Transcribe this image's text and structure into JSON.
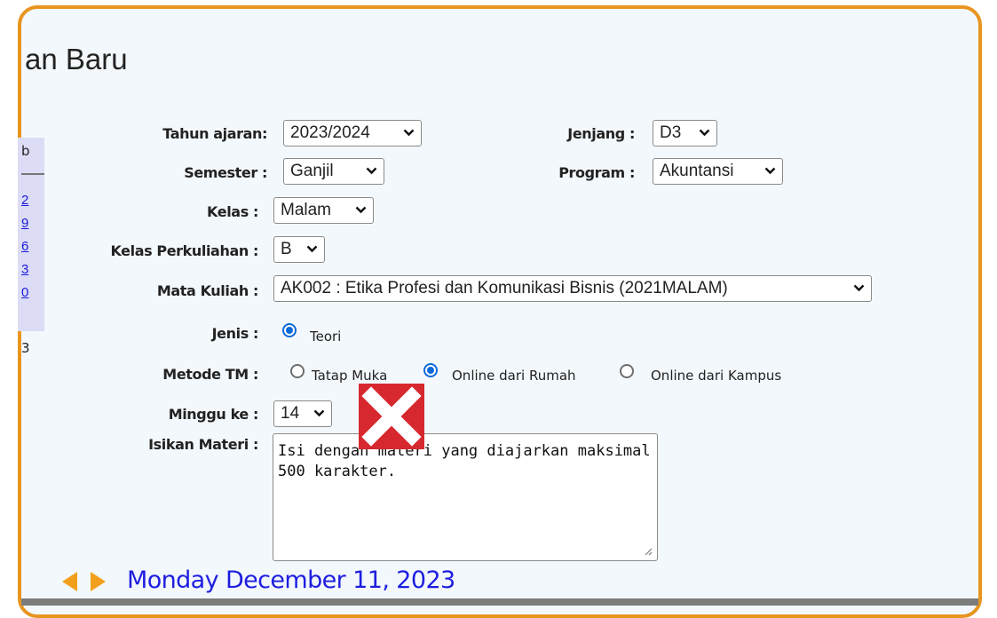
{
  "page_title": "an Baru",
  "sidebar": {
    "header": "b",
    "links": [
      "2",
      "9",
      "6",
      "3",
      "0"
    ],
    "extra": "3"
  },
  "form": {
    "tahun_ajaran": {
      "label": "Tahun ajaran:",
      "value": "2023/2024"
    },
    "jenjang": {
      "label": "Jenjang :",
      "value": "D3"
    },
    "semester": {
      "label": "Semester :",
      "value": "Ganjil"
    },
    "program": {
      "label": "Program :",
      "value": "Akuntansi"
    },
    "kelas": {
      "label": "Kelas :",
      "value": "Malam"
    },
    "kelas_perkuliahan": {
      "label": "Kelas Perkuliahan :",
      "value": "B"
    },
    "mata_kuliah": {
      "label": "Mata Kuliah :",
      "value": "AK002 : Etika Profesi dan Komunikasi Bisnis (2021MALAM)"
    },
    "jenis": {
      "label": "Jenis :",
      "options": [
        {
          "label": "Teori",
          "checked": true
        }
      ]
    },
    "metode_tm": {
      "label": "Metode TM :",
      "options": [
        {
          "label": "Tatap Muka",
          "checked": false
        },
        {
          "label": "Online dari Rumah",
          "checked": true
        },
        {
          "label": "Online dari Kampus",
          "checked": false
        }
      ]
    },
    "minggu_ke": {
      "label": "Minggu ke :",
      "value": "14"
    },
    "isikan_materi": {
      "label": "Isikan Materi :",
      "placeholder": "Isi dengan materi yang diajarkan maksimal 500 karakter."
    }
  },
  "footer": {
    "date": "Monday December 11, 2023"
  },
  "colors": {
    "frame_border": "#e8951f",
    "link": "#1a1ad8",
    "close_icon": "#d7282f",
    "date": "#1e1ee0",
    "arrows": "#f2a01c"
  },
  "icons": {
    "close": "close-icon",
    "prev": "arrow-left-icon",
    "next": "arrow-right-icon"
  }
}
